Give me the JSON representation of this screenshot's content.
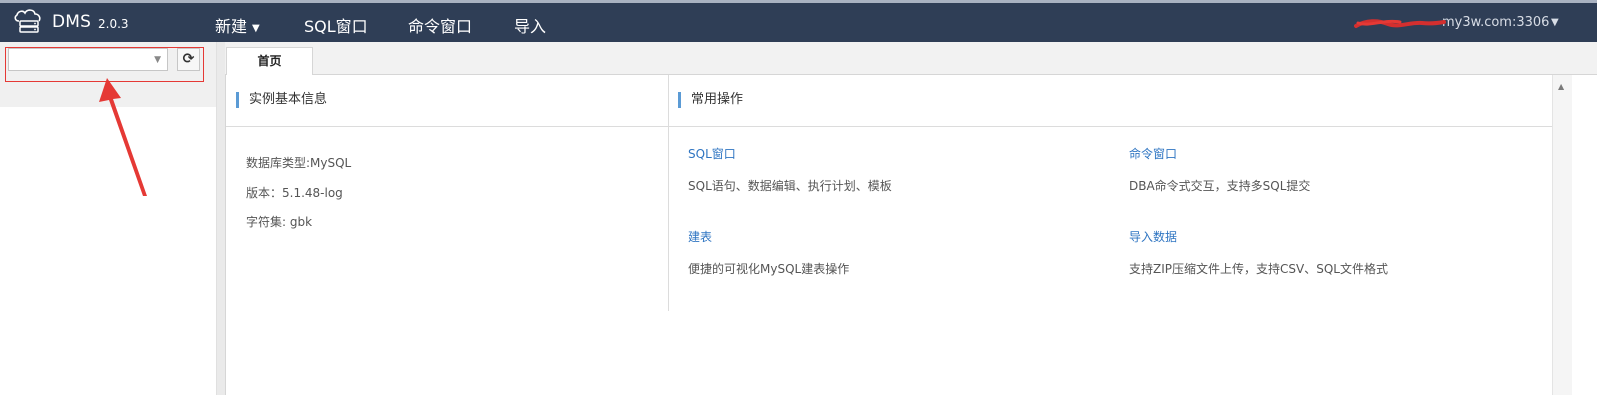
{
  "app": {
    "name": "DMS",
    "version": "2.0.3"
  },
  "nav": {
    "new_label": "新建",
    "sql_window": "SQL窗口",
    "command_window": "命令窗口",
    "import": "导入"
  },
  "connection": {
    "host_label": "my3w.com:3306"
  },
  "sidebar": {
    "db_select_value": "",
    "refresh_icon": "refresh-icon"
  },
  "tabs": [
    {
      "label": "首页"
    }
  ],
  "instance_info": {
    "title": "实例基本信息",
    "db_type": "数据库类型:MySQL",
    "version": "版本：5.1.48-log",
    "charset": "字符集: gbk"
  },
  "common_ops": {
    "title": "常用操作",
    "items": [
      {
        "title": "SQL窗口",
        "desc": "SQL语句、数据编辑、执行计划、模板"
      },
      {
        "title": "命令窗口",
        "desc": "DBA命令式交互，支持多SQL提交"
      },
      {
        "title": "建表",
        "desc": "便捷的可视化MySQL建表操作"
      },
      {
        "title": "导入数据",
        "desc": "支持ZIP压缩文件上传，支持CSV、SQL文件格式"
      }
    ]
  },
  "colors": {
    "header_bg": "#2f3e56",
    "accent": "#5b9bd5",
    "link": "#2f75c2",
    "annotation": "#e53935"
  }
}
